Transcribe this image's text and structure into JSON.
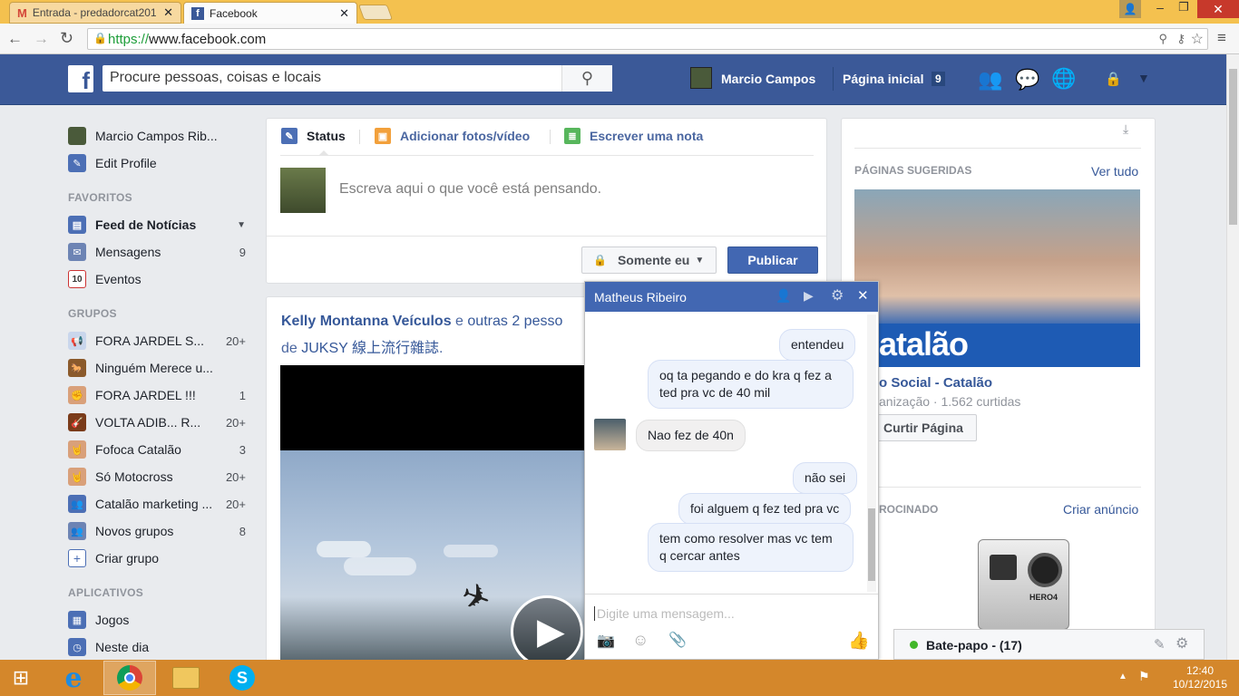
{
  "browser": {
    "tabs": [
      {
        "label": "Entrada - predadorcat201",
        "icon": "gmail-icon",
        "active": false
      },
      {
        "label": "Facebook",
        "icon": "facebook-icon",
        "active": true
      }
    ],
    "url_scheme": "https://",
    "url_host": "www.facebook.com"
  },
  "header": {
    "search_placeholder": "Procure pessoas, coisas e locais",
    "user_name": "Marcio Campos",
    "home_label": "Página inicial",
    "home_count": "9"
  },
  "sidebar": {
    "profile_name": "Marcio Campos Rib...",
    "edit_profile": "Edit Profile",
    "favorites_heading": "FAVORITOS",
    "favorites": [
      {
        "label": "Feed de Notícias",
        "count": "",
        "icon": "news-feed-icon"
      },
      {
        "label": "Mensagens",
        "count": "9",
        "icon": "messages-icon"
      },
      {
        "label": "Eventos",
        "count": "",
        "icon": "calendar-icon",
        "badge": "10"
      }
    ],
    "groups_heading": "GRUPOS",
    "groups": [
      {
        "label": "FORA JARDEL S...",
        "count": "20+",
        "icon": "megaphone-icon"
      },
      {
        "label": "Ninguém Merece u...",
        "count": "",
        "icon": "horse-icon"
      },
      {
        "label": "FORA JARDEL !!!",
        "count": "1",
        "icon": "fist-icon"
      },
      {
        "label": "VOLTA ADIB... R...",
        "count": "20+",
        "icon": "guitar-icon"
      },
      {
        "label": "Fofoca Catalão",
        "count": "3",
        "icon": "rock-hand-icon"
      },
      {
        "label": "Só Motocross",
        "count": "20+",
        "icon": "rock-hand-icon"
      },
      {
        "label": "Catalão marketing ...",
        "count": "20+",
        "icon": "group-icon"
      },
      {
        "label": "Novos grupos",
        "count": "8",
        "icon": "group-icon"
      },
      {
        "label": "Criar grupo",
        "count": "",
        "icon": "plus-icon"
      }
    ],
    "apps_heading": "APLICATIVOS",
    "apps": [
      {
        "label": "Jogos",
        "icon": "games-icon"
      },
      {
        "label": "Neste dia",
        "icon": "clock-icon"
      }
    ]
  },
  "composer": {
    "tab_status": "Status",
    "tab_photo": "Adicionar fotos/vídeo",
    "tab_note": "Escrever uma nota",
    "placeholder": "Escreva aqui o que você está pensando.",
    "privacy": "Somente eu",
    "publish": "Publicar"
  },
  "post": {
    "author": "Kelly Montanna Veículos",
    "and_text": " e ",
    "others": "outras 2 pesso",
    "line2_prefix": "de ",
    "page": "JUKSY 線上流行雜誌",
    "line2_suffix": "."
  },
  "right": {
    "suggested_heading": "PÁGINAS SUGERIDAS",
    "see_all": "Ver tudo",
    "page_name": "o Social - Catalão",
    "page_meta": "anização · 1.562 curtidas",
    "like_page": "Curtir Página",
    "banner_text": "Catalão",
    "sponsored_heading": "ROCINADO",
    "create_ad": "Criar anúncio",
    "product_label": "HERO4"
  },
  "chat": {
    "title": "Matheus Ribeiro",
    "messages": [
      {
        "text": "entendeu",
        "from": "me"
      },
      {
        "text": "oq ta pegando e do kra q fez a ted pra vc de 40 mil",
        "from": "me"
      },
      {
        "text": "Nao fez de 40n",
        "from": "them"
      },
      {
        "text": "não sei",
        "from": "me"
      },
      {
        "text": "foi alguem q fez ted pra vc",
        "from": "me"
      },
      {
        "text": "tem como resolver mas vc tem q cercar antes",
        "from": "me"
      }
    ],
    "input_placeholder": "Digite uma mensagem..."
  },
  "chatbar": {
    "label": "Bate-papo - (17)"
  },
  "taskbar": {
    "time": "12:40",
    "date": "10/12/2015"
  },
  "colors": {
    "facebook_blue": "#3b5998",
    "taskbar": "#d4872b",
    "tabstrip": "#f4c14f"
  }
}
